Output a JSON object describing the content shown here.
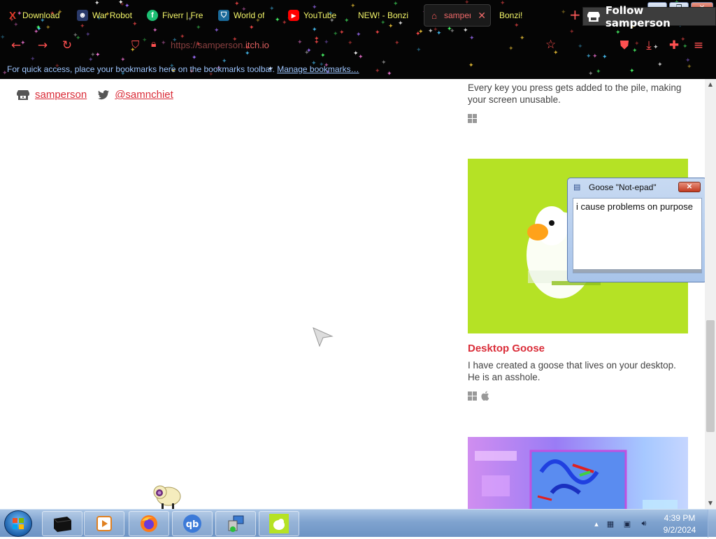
{
  "browser": {
    "tabs": [
      {
        "title": "Download",
        "icon": "x-icon",
        "color": "#e23a2a"
      },
      {
        "title": "War Robot",
        "icon": "robot-icon",
        "color": "#2a3a6a"
      },
      {
        "title": "Fiverr | Fre",
        "icon": "fiverr-icon",
        "color": "#1dbf73"
      },
      {
        "title": "World of",
        "icon": "shield-icon",
        "color": "#1a6a9a"
      },
      {
        "title": "YouTube",
        "icon": "youtube-icon",
        "color": "#ff0000"
      },
      {
        "title": "NEW! - Bonzi",
        "icon": "",
        "color": ""
      },
      {
        "title": "samper",
        "icon": "itchio-icon",
        "color": "#fa5c5c",
        "active": true
      },
      {
        "title": "Bonzi!",
        "icon": "",
        "color": ""
      }
    ],
    "new_tab_label": "+",
    "tab_list_label": "⌄",
    "url": {
      "prefix": "https://samperson.",
      "domain": "itch.io"
    },
    "bookmarks_bar": {
      "text": "For quick access, place your bookmarks here on the bookmarks toolbar.",
      "link": "Manage bookmarks…"
    }
  },
  "page": {
    "profile": {
      "itch_name": "samperson",
      "twitter": "@samnchiet"
    },
    "follow_button": "Follow samperson",
    "games": [
      {
        "description": "Every key you press gets added to the pile, making your screen unusable.",
        "platforms": [
          "windows"
        ]
      },
      {
        "title": "Desktop Goose",
        "description": "I have created a goose that lives on your desktop. He is an asshole.",
        "platforms": [
          "windows",
          "apple"
        ]
      },
      {
        "title": "",
        "description": "",
        "platforms": []
      }
    ]
  },
  "notepad": {
    "title": "Goose \"Not-epad\"",
    "body": "i cause problems on purpose",
    "close_label": "✕"
  },
  "taskbar": {
    "clock_time": "4:39 PM",
    "clock_date": "9/2/2024",
    "pinned": [
      "explorer-icon",
      "media-player-icon",
      "firefox-icon",
      "qbittorrent-icon",
      "network-icon",
      "desktop-goose-icon"
    ]
  },
  "colors": {
    "accent": "#da2c38",
    "chrome_bg": "#050505",
    "goose_bg": "#b5e225"
  }
}
